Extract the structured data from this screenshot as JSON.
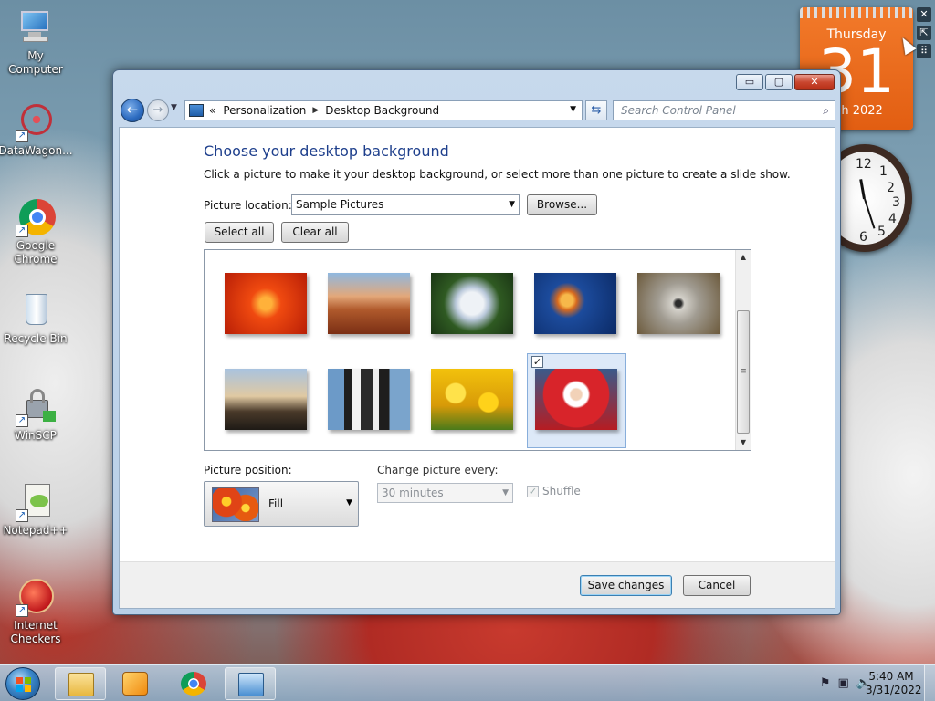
{
  "desktop": {
    "icons": [
      {
        "label": "My Computer",
        "icon": "computer-icon"
      },
      {
        "label": "DataWagon...",
        "icon": "datawagon-icon"
      },
      {
        "label": "Google Chrome",
        "icon": "chrome-icon"
      },
      {
        "label": "Recycle Bin",
        "icon": "recycle-bin-icon"
      },
      {
        "label": "WinSCP",
        "icon": "winscp-icon"
      },
      {
        "label": "Notepad++",
        "icon": "notepadpp-icon"
      },
      {
        "label": "Internet Checkers",
        "icon": "internet-checkers-icon"
      }
    ]
  },
  "gadgets": {
    "calendar": {
      "day_name": "Thursday",
      "day_number": "31",
      "month_year": "rch 2022"
    },
    "clock": {
      "numerals": [
        "12",
        "1",
        "2",
        "3",
        "4",
        "5",
        "6"
      ]
    }
  },
  "window": {
    "title_buttons": {
      "minimize": "▭",
      "maximize": "▢",
      "close": "✕"
    },
    "nav": {
      "back": "←",
      "forward": "→"
    },
    "address": {
      "prefix": "«",
      "crumbs": [
        "Personalization",
        "Desktop Background"
      ]
    },
    "search": {
      "placeholder": "Search Control Panel"
    },
    "heading": "Choose your desktop background",
    "subtext": "Click a picture to make it your desktop background, or select more than one picture to create a slide show.",
    "picture_location": {
      "label": "Picture location:",
      "value": "Sample Pictures"
    },
    "buttons": {
      "browse": "Browse...",
      "select_all": "Select all",
      "clear_all": "Clear all",
      "save": "Save changes",
      "cancel": "Cancel"
    },
    "thumbnails": [
      {
        "name": "chrysanthemum",
        "selected": false,
        "colors": [
          "#f04a10",
          "#b81e06"
        ]
      },
      {
        "name": "desert",
        "selected": false,
        "colors": [
          "#e08a52",
          "#7a2e14"
        ]
      },
      {
        "name": "hydrangeas",
        "selected": false,
        "colors": [
          "#d8e0ea",
          "#2f5a22"
        ]
      },
      {
        "name": "jellyfish",
        "selected": false,
        "colors": [
          "#1c4b9c",
          "#f0a03a"
        ]
      },
      {
        "name": "koala",
        "selected": false,
        "colors": [
          "#c9c6bf",
          "#6c5a3c"
        ]
      },
      {
        "name": "lighthouse",
        "selected": false,
        "colors": [
          "#7fa2c8",
          "#3a2a1c"
        ]
      },
      {
        "name": "penguins",
        "selected": false,
        "colors": [
          "#6c9ac8",
          "#2a2a2a"
        ]
      },
      {
        "name": "tulips",
        "selected": false,
        "colors": [
          "#f2c20c",
          "#c47e06"
        ]
      },
      {
        "name": "santa",
        "selected": true,
        "colors": [
          "#3b5a8a",
          "#d8242a"
        ]
      }
    ],
    "picture_position": {
      "label": "Picture position:",
      "value": "Fill"
    },
    "change_picture": {
      "label": "Change picture every:",
      "value": "30 minutes"
    },
    "shuffle": {
      "label": "Shuffle",
      "checked": true
    }
  },
  "taskbar": {
    "items": [
      {
        "name": "explorer",
        "pinned": true
      },
      {
        "name": "media-player",
        "pinned": false
      },
      {
        "name": "chrome",
        "pinned": false
      },
      {
        "name": "control-panel",
        "pinned": true
      }
    ],
    "clock": {
      "time": "5:40 AM",
      "date": "3/31/2022"
    }
  }
}
